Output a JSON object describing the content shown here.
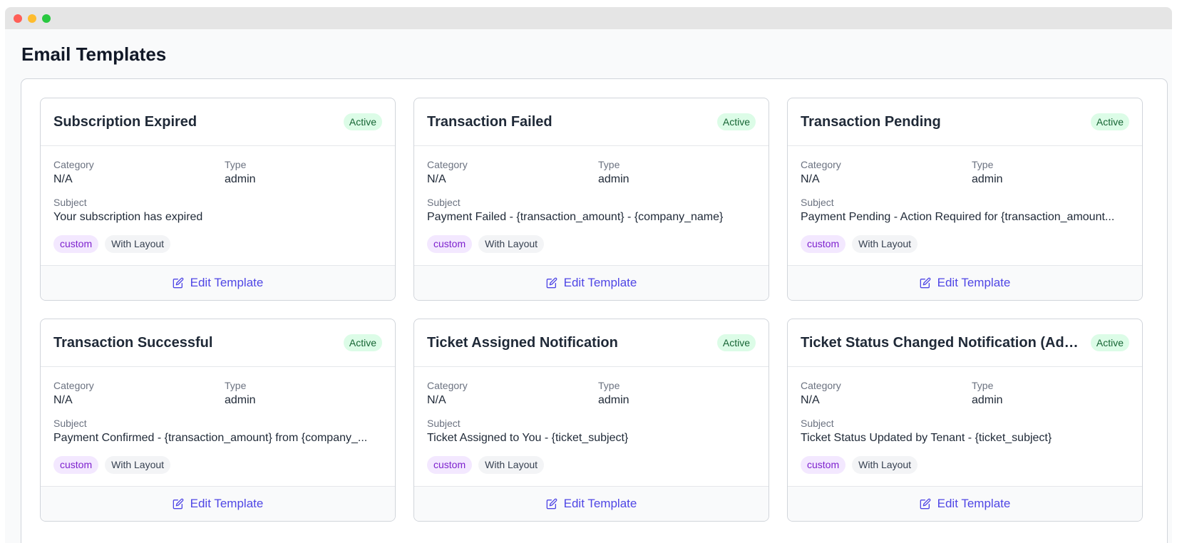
{
  "page": {
    "title": "Email Templates"
  },
  "labels": {
    "category": "Category",
    "type": "Type",
    "subject": "Subject",
    "edit": "Edit Template"
  },
  "colors": {
    "accent": "#4f46e5",
    "active_bg": "#dcfce7",
    "custom_tag": "#7e22ce"
  },
  "templates": [
    {
      "name": "Subscription Expired",
      "status": "Active",
      "category": "N/A",
      "type": "admin",
      "subject": "Your subscription has expired",
      "tags": [
        "custom",
        "With Layout"
      ]
    },
    {
      "name": "Transaction Failed",
      "status": "Active",
      "category": "N/A",
      "type": "admin",
      "subject": "Payment Failed - {transaction_amount} - {company_name}",
      "tags": [
        "custom",
        "With Layout"
      ]
    },
    {
      "name": "Transaction Pending",
      "status": "Active",
      "category": "N/A",
      "type": "admin",
      "subject": "Payment Pending - Action Required for {transaction_amount...",
      "tags": [
        "custom",
        "With Layout"
      ]
    },
    {
      "name": "Transaction Successful",
      "status": "Active",
      "category": "N/A",
      "type": "admin",
      "subject": "Payment Confirmed - {transaction_amount} from {company_...",
      "tags": [
        "custom",
        "With Layout"
      ]
    },
    {
      "name": "Ticket Assigned Notification",
      "status": "Active",
      "category": "N/A",
      "type": "admin",
      "subject": "Ticket Assigned to You - {ticket_subject}",
      "tags": [
        "custom",
        "With Layout"
      ]
    },
    {
      "name": "Ticket Status Changed Notification (Adm...",
      "status": "Active",
      "category": "N/A",
      "type": "admin",
      "subject": "Ticket Status Updated by Tenant - {ticket_subject}",
      "tags": [
        "custom",
        "With Layout"
      ]
    }
  ]
}
